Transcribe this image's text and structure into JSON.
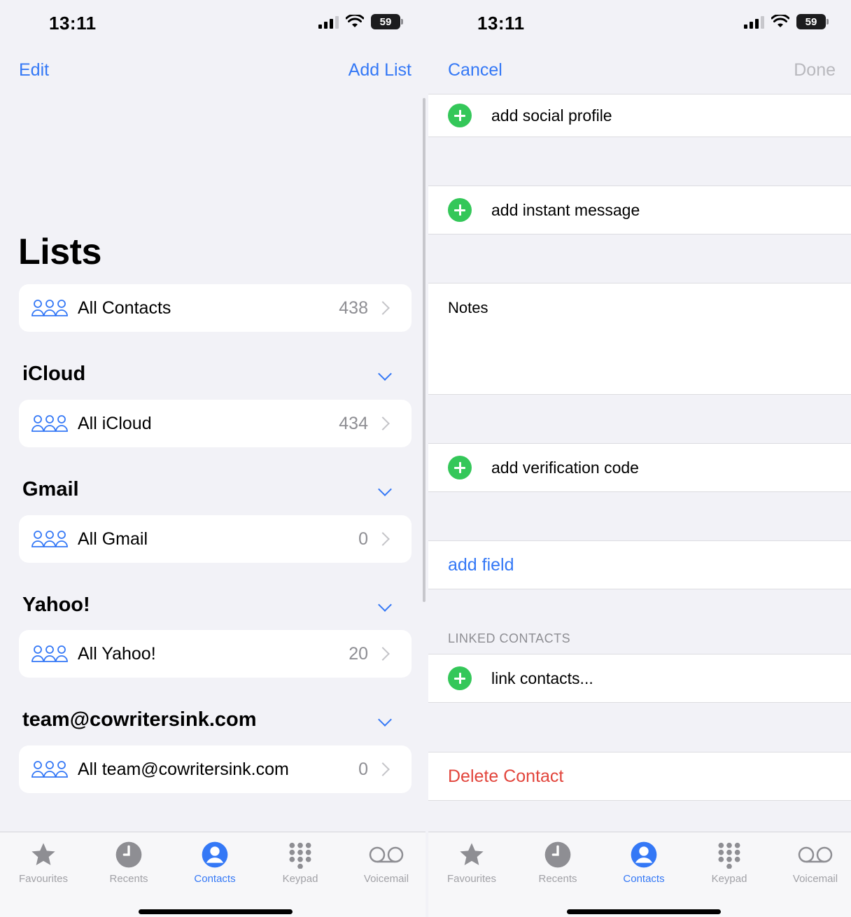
{
  "status": {
    "time": "13:11",
    "battery": "59"
  },
  "left": {
    "nav": {
      "left": "Edit",
      "right": "Add List"
    },
    "title": "Lists",
    "all_contacts": {
      "label": "All Contacts",
      "count": "438"
    },
    "sections": [
      {
        "header": "iCloud",
        "item": "All iCloud",
        "count": "434"
      },
      {
        "header": "Gmail",
        "item": "All Gmail",
        "count": "0"
      },
      {
        "header": "Yahoo!",
        "item": "All Yahoo!",
        "count": "20"
      },
      {
        "header": "team@cowritersink.com",
        "item": "All team@cowritersink.com",
        "count": "0"
      }
    ]
  },
  "right": {
    "nav": {
      "left": "Cancel",
      "right": "Done"
    },
    "rows": {
      "social": "add social profile",
      "im": "add instant message",
      "notes": "Notes",
      "verification": "add verification code",
      "add_field": "add field",
      "linked_caption": "LINKED CONTACTS",
      "link": "link contacts...",
      "delete": "Delete Contact"
    }
  },
  "tabs": [
    {
      "label": "Favourites",
      "icon": "star-icon"
    },
    {
      "label": "Recents",
      "icon": "clock-icon"
    },
    {
      "label": "Contacts",
      "icon": "person-icon"
    },
    {
      "label": "Keypad",
      "icon": "keypad-icon"
    },
    {
      "label": "Voicemail",
      "icon": "voicemail-icon"
    }
  ],
  "colors": {
    "accent": "#3478f6",
    "green": "#34c759",
    "destructive": "#e2453c",
    "background": "#f2f2f7"
  }
}
